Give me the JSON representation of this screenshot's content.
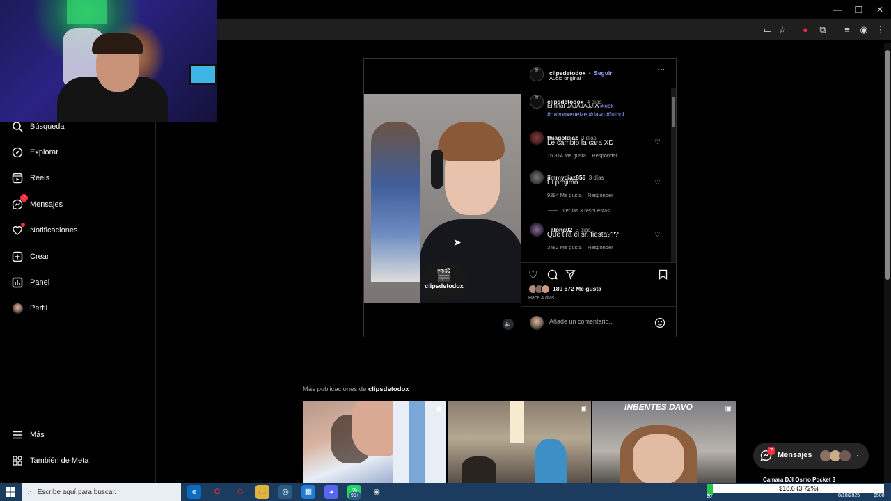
{
  "browser": {
    "window_controls": [
      "—",
      "❐",
      "✕"
    ],
    "toolbar_icons": [
      "screen-icon",
      "star-icon",
      "opera-icon",
      "extensions-icon",
      "media-icon",
      "profile-icon",
      "menu-icon"
    ]
  },
  "sidebar": {
    "items": [
      {
        "label": "Búsqueda",
        "icon": "search-icon"
      },
      {
        "label": "Explorar",
        "icon": "compass-icon"
      },
      {
        "label": "Reels",
        "icon": "reels-icon"
      },
      {
        "label": "Mensajes",
        "icon": "messenger-icon",
        "badge": "7"
      },
      {
        "label": "Notificaciones",
        "icon": "heart-icon",
        "dot": true
      },
      {
        "label": "Crear",
        "icon": "plus-square-icon"
      },
      {
        "label": "Panel",
        "icon": "chart-icon"
      },
      {
        "label": "Perfil",
        "icon": "avatar"
      }
    ],
    "bottom": [
      {
        "label": "Más",
        "icon": "hamburger-icon"
      },
      {
        "label": "También de Meta",
        "icon": "meta-icon"
      }
    ]
  },
  "post": {
    "video_logo_text": "clipsdetodox",
    "header": {
      "username": "clipsdetodox",
      "separator": "•",
      "follow": "Seguir",
      "audio": "Audio original",
      "more": "···"
    },
    "caption": {
      "username": "clipsdetodox",
      "time": "4 días",
      "text": "El final JAJAJAJJIA",
      "hashtags_line1": "#kick",
      "hashtags_line2": "#davooxeneize #davo #futbol"
    },
    "comments": [
      {
        "username": "thiagoldiaz",
        "time": "3 días",
        "text": "Le cambio la cara XD",
        "likes": "16 814 Me gusta",
        "reply": "Responder"
      },
      {
        "username": "jimmydiaz856",
        "time": "3 días",
        "text": "El projimo",
        "likes": "9394 Me gusta",
        "reply": "Responder",
        "view_replies": "Ver las 3 respuestas"
      },
      {
        "username": "_alpha02",
        "time": "3 días",
        "text": "Que tira el sr. fiesta???",
        "likes": "3482 Me gusta",
        "reply": "Responder"
      }
    ],
    "likes": "189 672 Me gusta",
    "posted": "Hace 4 días",
    "comment_placeholder": "Añade un comentario..."
  },
  "more_posts": {
    "prefix": "Más publicaciones de",
    "username": "clipsdetodox",
    "thumb3_title": "INBENTES DAVO"
  },
  "messages_pill": {
    "label": "Mensajes",
    "badge": "7"
  },
  "taskbar": {
    "search_placeholder": "Escribe aquí para buscar.",
    "chat_badge": "99+",
    "camera_title": "Camara DJI Osmo Pocket 3",
    "price": "$18.6 (3.72%)",
    "zero": "$0",
    "date": "8/10/2025",
    "ticker": "$500"
  }
}
